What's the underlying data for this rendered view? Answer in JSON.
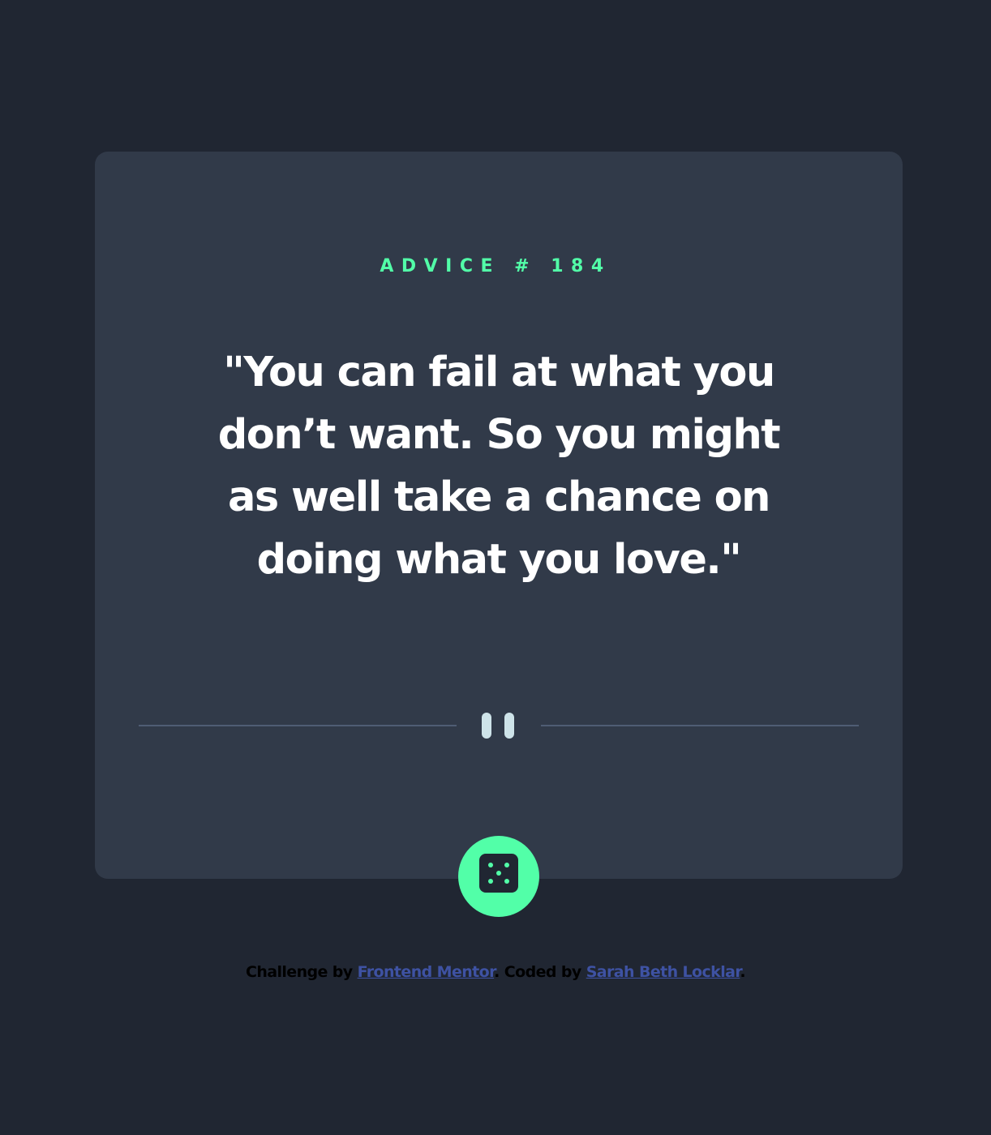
{
  "advice": {
    "id_label": "ADVICE # 184",
    "quote": "\"You can fail at what you don’t want. So you might as well take a chance on doing what you love.\""
  },
  "icons": {
    "divider": "pause-icon",
    "button": "dice-icon"
  },
  "attribution": {
    "challenge_prefix": "Challenge by ",
    "challenge_link": "Frontend Mentor",
    "coded_prefix": ". Coded by ",
    "coded_link": "Sarah Beth Locklar",
    "suffix": "."
  },
  "colors": {
    "background": "#202632",
    "card": "#313A49",
    "accent": "#52FFA8",
    "quote_text": "#FFFFFF",
    "divider": "#4F5D74",
    "link": "#3E52A3"
  }
}
